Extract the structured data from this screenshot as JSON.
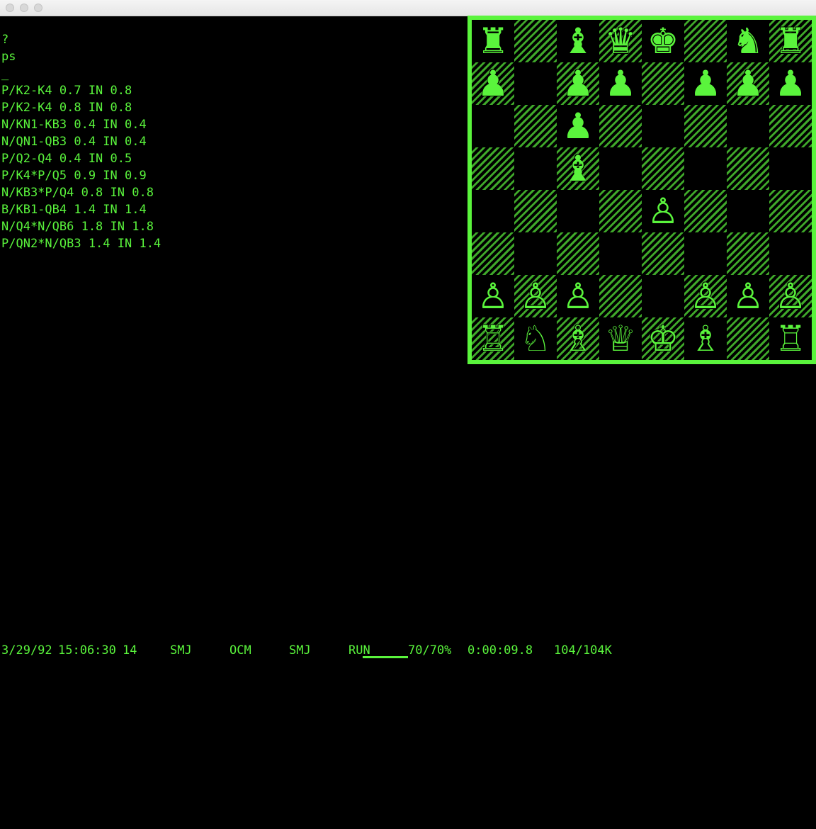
{
  "console": {
    "lines": [
      "?",
      "ps",
      "_",
      "P/K2-K4 0.7 IN 0.8",
      "P/K2-K4 0.8 IN 0.8",
      "N/KN1-KB3 0.4 IN 0.4",
      "N/QN1-QB3 0.4 IN 0.4",
      "P/Q2-Q4 0.4 IN 0.5",
      "P/K4*P/Q5 0.9 IN 0.9",
      "N/KB3*P/Q4 0.8 IN 0.8",
      "B/KB1-QB4 1.4 IN 1.4",
      "N/Q4*N/QB6 1.8 IN 1.8",
      "P/QN2*N/QB3 1.4 IN 1.4"
    ]
  },
  "board": {
    "ranks": [
      [
        "♜",
        "",
        "♝",
        "♛",
        "♚",
        "",
        "♞",
        "♜"
      ],
      [
        "♟",
        "",
        "♟",
        "♟",
        "",
        "♟",
        "♟",
        "♟"
      ],
      [
        "",
        "",
        "♟",
        "",
        "",
        "",
        "",
        ""
      ],
      [
        "",
        "",
        "♝",
        "",
        "",
        "",
        "",
        ""
      ],
      [
        "",
        "",
        "",
        "",
        "♙",
        "",
        "",
        ""
      ],
      [
        "",
        "",
        "",
        "",
        "",
        "",
        "",
        ""
      ],
      [
        "♙",
        "♙",
        "♙",
        "",
        "",
        "♙",
        "♙",
        "♙"
      ],
      [
        "♖",
        "♘",
        "♗",
        "♕",
        "♔",
        "♗",
        "",
        "♖"
      ]
    ]
  },
  "status": {
    "date": "3/29/92",
    "time": "15:06:30",
    "num": "14",
    "user1": "SMJ",
    "ocm": "OCM",
    "user2": "SMJ",
    "run": "RUN",
    "load": "70/70%",
    "elapsed": "0:00:09.8",
    "mem": "104/104K"
  },
  "colors": {
    "foreground": "#5af43c",
    "background": "#000000"
  }
}
